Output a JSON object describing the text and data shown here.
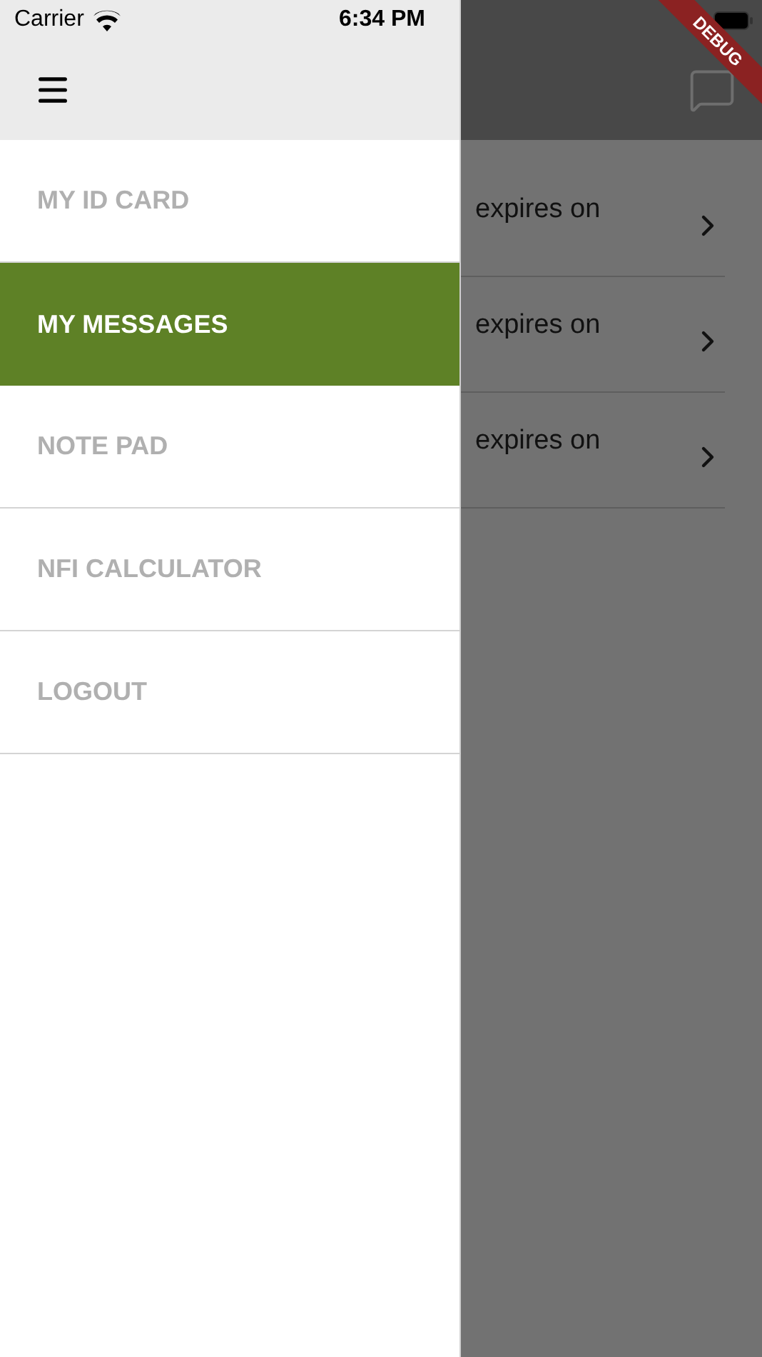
{
  "status_bar": {
    "carrier": "Carrier",
    "time": "6:34 PM"
  },
  "debug_banner": "DEBUG",
  "drawer": {
    "items": [
      {
        "label": "MY ID CARD",
        "selected": false
      },
      {
        "label": "MY MESSAGES",
        "selected": true
      },
      {
        "label": "NOTE PAD",
        "selected": false
      },
      {
        "label": "NFI CALCULATOR",
        "selected": false
      },
      {
        "label": "LOGOUT",
        "selected": false
      }
    ]
  },
  "messages": [
    {
      "text": "expires on"
    },
    {
      "text": "expires on"
    },
    {
      "text": "expires on"
    }
  ]
}
